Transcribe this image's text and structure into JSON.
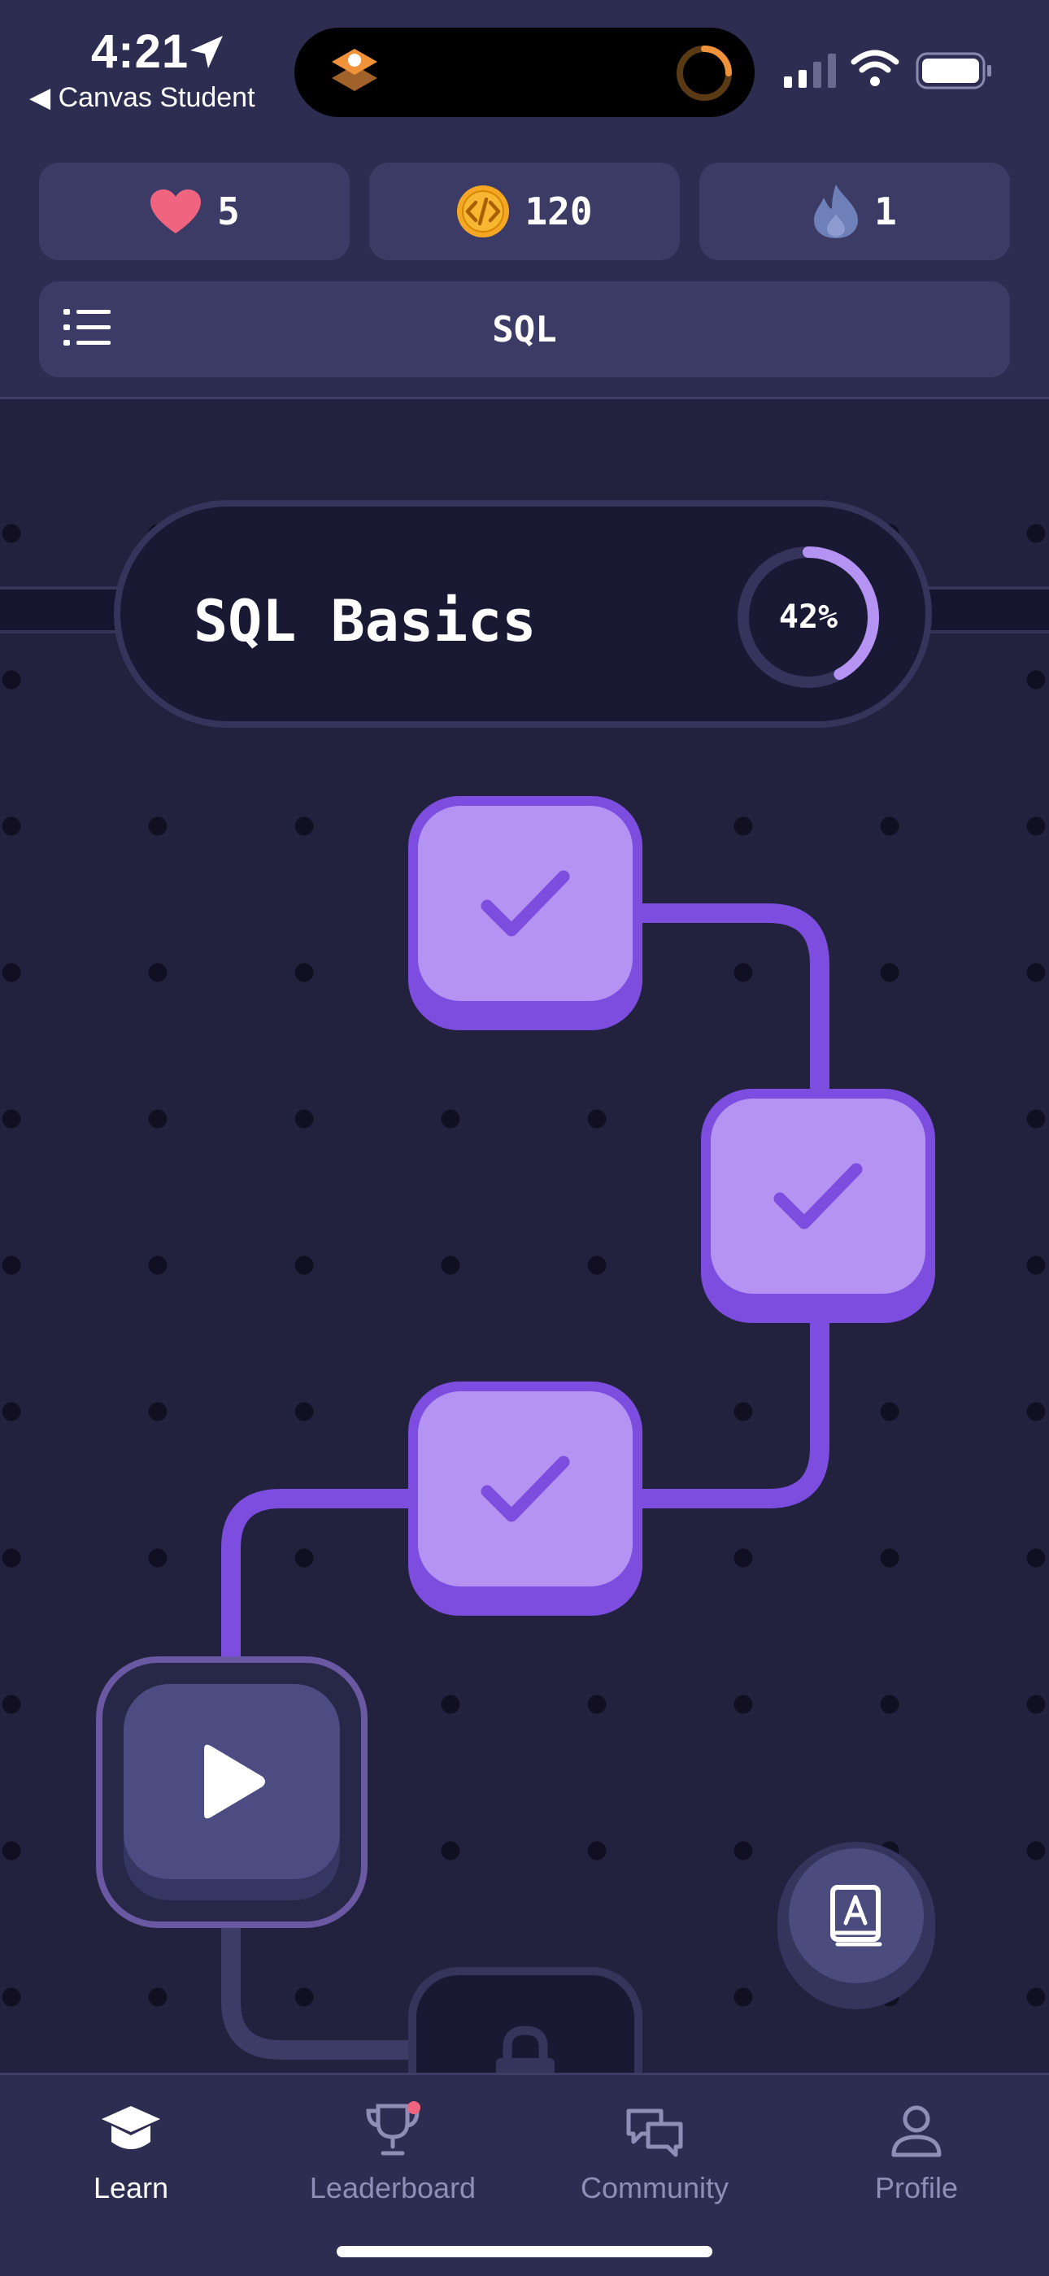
{
  "status_bar": {
    "time": "4:21",
    "back_label": "Canvas Student"
  },
  "stats": {
    "hearts": "5",
    "coins": "120",
    "streak": "1"
  },
  "course": {
    "title": "SQL"
  },
  "unit": {
    "title": "SQL Basics",
    "progress_label": "42%",
    "progress": 0.42
  },
  "lessons": [
    {
      "state": "completed"
    },
    {
      "state": "completed"
    },
    {
      "state": "completed"
    },
    {
      "state": "current"
    },
    {
      "state": "locked"
    }
  ],
  "nav": {
    "items": [
      {
        "label": "Learn",
        "active": true
      },
      {
        "label": "Leaderboard",
        "active": false
      },
      {
        "label": "Community",
        "active": false
      },
      {
        "label": "Profile",
        "active": false
      }
    ]
  },
  "colors": {
    "background": "#22223f",
    "header": "#2d2d52",
    "card": "#3b3b66",
    "accent_purple": "#7c4ddf",
    "completed_face": "#b493f3",
    "heart": "#f0647f",
    "coin": "#f5a623",
    "notification": "#f0647f"
  },
  "icons": {
    "menu": "list-icon",
    "heart": "heart-icon",
    "coin": "code-coin-icon",
    "streak": "flame-icon",
    "completed": "checkmark-icon",
    "current": "play-icon",
    "locked": "lock-icon",
    "glossary": "book-icon"
  }
}
